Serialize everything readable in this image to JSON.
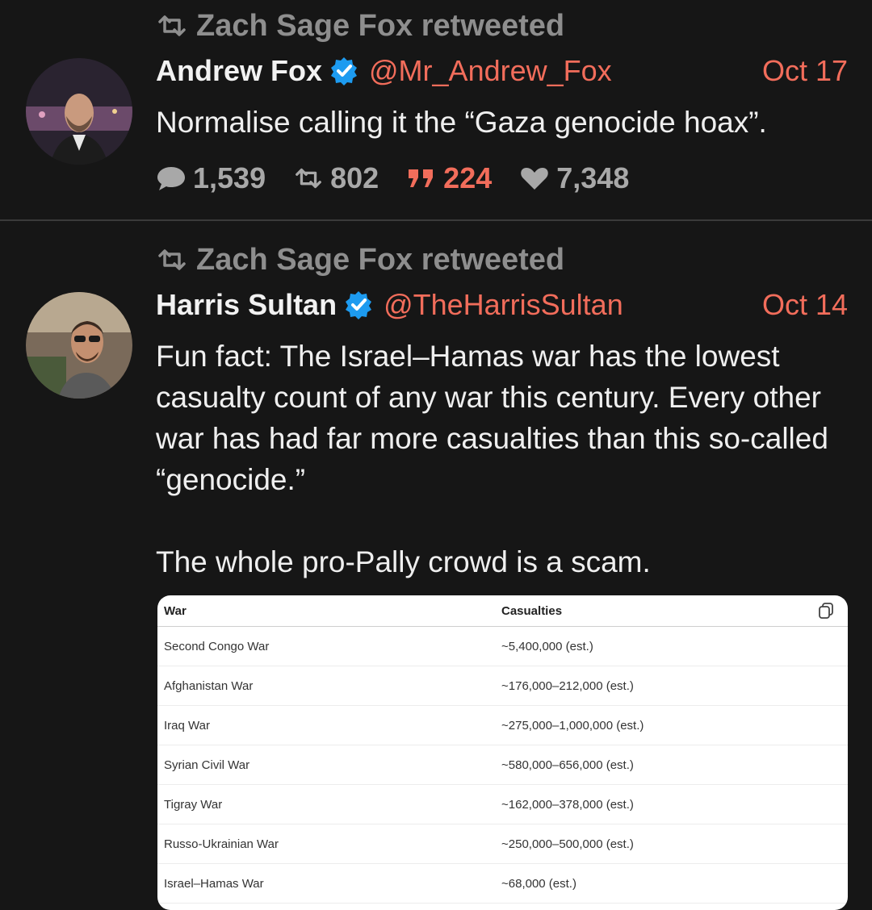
{
  "tweets": [
    {
      "retweet_label": "Zach Sage Fox retweeted",
      "author_name": "Andrew Fox",
      "handle": "@Mr_Andrew_Fox",
      "date": "Oct 17",
      "text": "Normalise calling it the “Gaza genocide hoax”.",
      "stats": {
        "replies": "1,539",
        "retweets": "802",
        "quotes": "224",
        "likes": "7,348"
      }
    },
    {
      "retweet_label": "Zach Sage Fox retweeted",
      "author_name": "Harris Sultan",
      "handle": "@TheHarrisSultan",
      "date": "Oct 14",
      "text": "Fun fact: The Israel–Hamas war has the lowest casualty count of any war this century. Every other war has had far more casualties than this so-called “genocide.”\n\nThe whole pro-Pally crowd is a scam.",
      "table": {
        "headers": [
          "War",
          "Casualties"
        ],
        "rows": [
          [
            "Second Congo War",
            "~5,400,000 (est.)"
          ],
          [
            "Afghanistan War",
            "~176,000–212,000 (est.)"
          ],
          [
            "Iraq War",
            "~275,000–1,000,000 (est.)"
          ],
          [
            "Syrian Civil War",
            "~580,000–656,000 (est.)"
          ],
          [
            "Tigray War",
            "~162,000–378,000 (est.)"
          ],
          [
            "Russo-Ukrainian War",
            "~250,000–500,000 (est.)"
          ],
          [
            "Israel–Hamas War",
            "~68,000 (est.)"
          ]
        ]
      }
    }
  ],
  "icons": {
    "retweet": "retweet-icon",
    "verified": "verified-badge-icon",
    "reply": "reply-bubble-icon",
    "quote": "quote-icon",
    "like": "heart-icon",
    "copy": "copy-icon"
  },
  "colors": {
    "background": "#161616",
    "accent": "#f26d5b",
    "verified": "#1d9bf0",
    "muted": "#8e8e8e"
  }
}
